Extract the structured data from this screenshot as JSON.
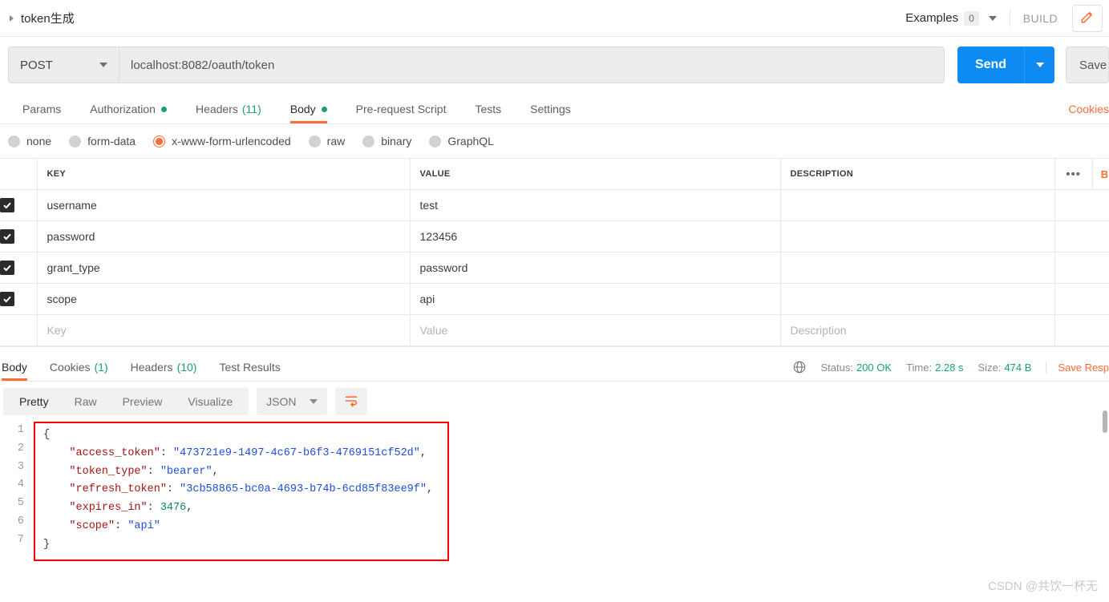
{
  "topbar": {
    "breadcrumb_arrow_icon": "triangle-right-icon",
    "title": "token生成",
    "examples_label": "Examples",
    "examples_count": "0",
    "examples_caret_icon": "chevron-down-icon",
    "build_label": "BUILD",
    "edit_icon": "pencil-icon"
  },
  "request": {
    "method": "POST",
    "method_caret_icon": "chevron-down-icon",
    "url": "localhost:8082/oauth/token",
    "send_label": "Send",
    "send_caret_icon": "chevron-down-icon",
    "save_label": "Save",
    "cookies_label": "Cookies",
    "tabs": [
      {
        "label": "Params",
        "badge": "",
        "dot": false,
        "active": false
      },
      {
        "label": "Authorization",
        "badge": "",
        "dot": true,
        "active": false
      },
      {
        "label": "Headers",
        "badge": "(11)",
        "dot": false,
        "active": false
      },
      {
        "label": "Body",
        "badge": "",
        "dot": true,
        "active": true
      },
      {
        "label": "Pre-request Script",
        "badge": "",
        "dot": false,
        "active": false
      },
      {
        "label": "Tests",
        "badge": "",
        "dot": false,
        "active": false
      },
      {
        "label": "Settings",
        "badge": "",
        "dot": false,
        "active": false
      }
    ],
    "body_types": [
      {
        "label": "none",
        "selected": false
      },
      {
        "label": "form-data",
        "selected": false
      },
      {
        "label": "x-www-form-urlencoded",
        "selected": true
      },
      {
        "label": "raw",
        "selected": false
      },
      {
        "label": "binary",
        "selected": false
      },
      {
        "label": "GraphQL",
        "selected": false
      }
    ],
    "table": {
      "headers": {
        "key": "KEY",
        "value": "VALUE",
        "description": "DESCRIPTION"
      },
      "more_icon": "ellipsis-icon",
      "bulk_edit_label": "B",
      "rows": [
        {
          "checked": true,
          "key": "username",
          "value": "test",
          "description": ""
        },
        {
          "checked": true,
          "key": "password",
          "value": "123456",
          "description": ""
        },
        {
          "checked": true,
          "key": "grant_type",
          "value": "password",
          "description": ""
        },
        {
          "checked": true,
          "key": "scope",
          "value": "api",
          "description": ""
        }
      ],
      "placeholder_row": {
        "key": "Key",
        "value": "Value",
        "description": "Description"
      }
    }
  },
  "response": {
    "tabs": [
      {
        "label": "Body",
        "badge": "",
        "active": true
      },
      {
        "label": "Cookies",
        "badge": "(1)",
        "active": false
      },
      {
        "label": "Headers",
        "badge": "(10)",
        "active": false
      },
      {
        "label": "Test Results",
        "badge": "",
        "active": false
      }
    ],
    "globe_icon": "globe-icon",
    "status_label": "Status:",
    "status_value": "200 OK",
    "time_label": "Time:",
    "time_value": "2.28 s",
    "size_label": "Size:",
    "size_value": "474 B",
    "save_response_label": "Save Resp",
    "viewer": {
      "modes": [
        {
          "label": "Pretty",
          "active": true
        },
        {
          "label": "Raw",
          "active": false
        },
        {
          "label": "Preview",
          "active": false
        },
        {
          "label": "Visualize",
          "active": false
        }
      ],
      "format": "JSON",
      "format_caret_icon": "chevron-down-icon",
      "wrap_icon": "word-wrap-icon"
    },
    "body": {
      "line_numbers": [
        "1",
        "2",
        "3",
        "4",
        "5",
        "6",
        "7"
      ],
      "lines": [
        {
          "indent": 0,
          "parts": [
            {
              "t": "p",
              "v": "{"
            }
          ]
        },
        {
          "indent": 1,
          "parts": [
            {
              "t": "k",
              "v": "\"access_token\""
            },
            {
              "t": "p",
              "v": ": "
            },
            {
              "t": "s",
              "v": "\"473721e9-1497-4c67-b6f3-4769151cf52d\""
            },
            {
              "t": "p",
              "v": ","
            }
          ]
        },
        {
          "indent": 1,
          "parts": [
            {
              "t": "k",
              "v": "\"token_type\""
            },
            {
              "t": "p",
              "v": ": "
            },
            {
              "t": "s",
              "v": "\"bearer\""
            },
            {
              "t": "p",
              "v": ","
            }
          ]
        },
        {
          "indent": 1,
          "parts": [
            {
              "t": "k",
              "v": "\"refresh_token\""
            },
            {
              "t": "p",
              "v": ": "
            },
            {
              "t": "s",
              "v": "\"3cb58865-bc0a-4693-b74b-6cd85f83ee9f\""
            },
            {
              "t": "p",
              "v": ","
            }
          ]
        },
        {
          "indent": 1,
          "parts": [
            {
              "t": "k",
              "v": "\"expires_in\""
            },
            {
              "t": "p",
              "v": ": "
            },
            {
              "t": "n",
              "v": "3476"
            },
            {
              "t": "p",
              "v": ","
            }
          ]
        },
        {
          "indent": 1,
          "parts": [
            {
              "t": "k",
              "v": "\"scope\""
            },
            {
              "t": "p",
              "v": ": "
            },
            {
              "t": "s",
              "v": "\"api\""
            }
          ]
        },
        {
          "indent": 0,
          "parts": [
            {
              "t": "p",
              "v": "}"
            }
          ]
        }
      ]
    }
  },
  "watermark": "CSDN @共饮一杯无",
  "colors": {
    "accent_orange": "#ff6c37",
    "send_blue": "#0d8bf2",
    "status_green": "#19a463",
    "highlight_red": "#ff0000"
  }
}
